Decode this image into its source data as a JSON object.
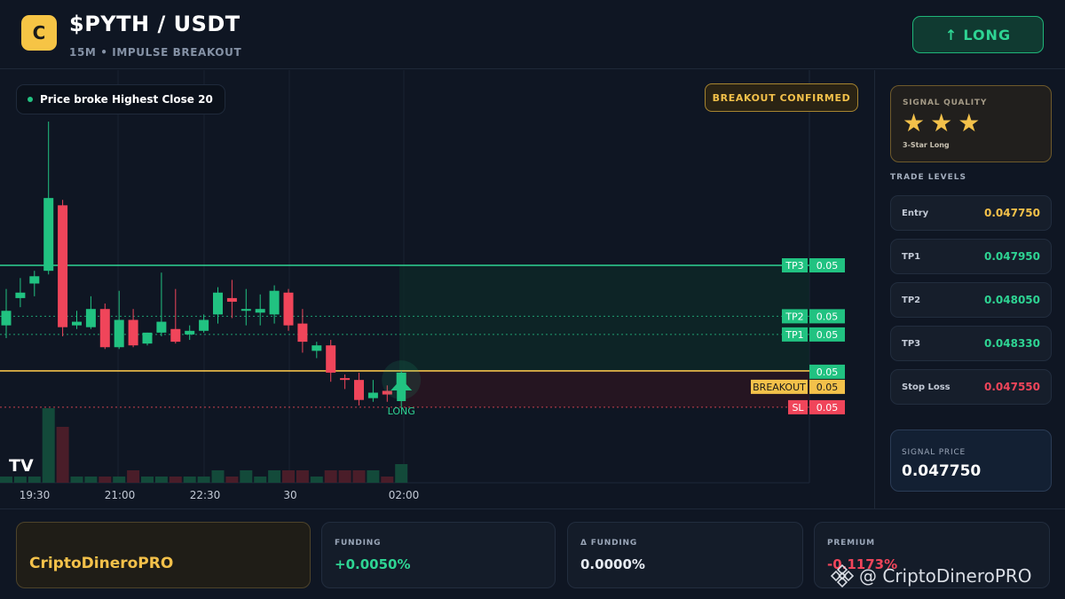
{
  "header": {
    "logo_letter": "C",
    "pair": "$PYTH / USDT",
    "subtitle": "15M • IMPULSE BREAKOUT",
    "long_button": "LONG",
    "long_arrow": "↑"
  },
  "chart": {
    "info_pill": "Price broke Highest Close 20",
    "badge": "BREAKOUT CONFIRMED",
    "signal_marker_label": "LONG",
    "tv_logo": "TV",
    "time_labels": [
      "19:30",
      "21:00",
      "22:30",
      "30",
      "02:00"
    ],
    "price_tags": [
      {
        "name": "TP3",
        "value": "0.05"
      },
      {
        "name": "TP2",
        "value": "0.05"
      },
      {
        "name": "TP1",
        "value": "0.05"
      },
      {
        "name": "",
        "value": "0.05"
      },
      {
        "name": "BREAKOUT",
        "value": "0.05"
      },
      {
        "name": "SL",
        "value": "0.05"
      }
    ],
    "colors": {
      "up": "#21c281",
      "down": "#f0455a",
      "breakout": "#f3c14a"
    }
  },
  "chart_data": {
    "type": "candlestick",
    "price_levels": {
      "TP3": 0.04833,
      "TP2": 0.04805,
      "TP1": 0.04795,
      "Entry": 0.04775,
      "Stop Loss": 0.04755
    },
    "candles": [
      {
        "o": 0.048,
        "h": 0.0482,
        "l": 0.04793,
        "c": 0.04808,
        "v": 1
      },
      {
        "o": 0.04815,
        "h": 0.04826,
        "l": 0.0481,
        "c": 0.04818,
        "v": 1
      },
      {
        "o": 0.04823,
        "h": 0.0483,
        "l": 0.04816,
        "c": 0.04827,
        "v": 1
      },
      {
        "o": 0.0483,
        "h": 0.04912,
        "l": 0.04828,
        "c": 0.0487,
        "v": 12
      },
      {
        "o": 0.04866,
        "h": 0.04869,
        "l": 0.04794,
        "c": 0.04799,
        "v": 9
      },
      {
        "o": 0.048,
        "h": 0.04808,
        "l": 0.04798,
        "c": 0.04802,
        "v": 1
      },
      {
        "o": 0.04799,
        "h": 0.04816,
        "l": 0.04798,
        "c": 0.04809,
        "v": 1
      },
      {
        "o": 0.04809,
        "h": 0.04812,
        "l": 0.04787,
        "c": 0.04788,
        "v": 1
      },
      {
        "o": 0.04788,
        "h": 0.04819,
        "l": 0.04787,
        "c": 0.04803,
        "v": 1
      },
      {
        "o": 0.04803,
        "h": 0.04809,
        "l": 0.04788,
        "c": 0.04789,
        "v": 2
      },
      {
        "o": 0.0479,
        "h": 0.04796,
        "l": 0.04789,
        "c": 0.04796,
        "v": 1
      },
      {
        "o": 0.04796,
        "h": 0.04829,
        "l": 0.04794,
        "c": 0.04802,
        "v": 1
      },
      {
        "o": 0.04798,
        "h": 0.0482,
        "l": 0.0479,
        "c": 0.04791,
        "v": 1
      },
      {
        "o": 0.04795,
        "h": 0.048,
        "l": 0.04792,
        "c": 0.04797,
        "v": 1
      },
      {
        "o": 0.04797,
        "h": 0.04806,
        "l": 0.04796,
        "c": 0.04803,
        "v": 1
      },
      {
        "o": 0.04806,
        "h": 0.04821,
        "l": 0.04801,
        "c": 0.04818,
        "v": 2
      },
      {
        "o": 0.04815,
        "h": 0.04825,
        "l": 0.04804,
        "c": 0.04813,
        "v": 1
      },
      {
        "o": 0.04808,
        "h": 0.0482,
        "l": 0.048,
        "c": 0.04809,
        "v": 2
      },
      {
        "o": 0.04807,
        "h": 0.04817,
        "l": 0.048,
        "c": 0.04809,
        "v": 1
      },
      {
        "o": 0.04806,
        "h": 0.04822,
        "l": 0.04801,
        "c": 0.04819,
        "v": 2
      },
      {
        "o": 0.04818,
        "h": 0.0482,
        "l": 0.04797,
        "c": 0.048,
        "v": 2
      },
      {
        "o": 0.04801,
        "h": 0.04809,
        "l": 0.04785,
        "c": 0.04791,
        "v": 2
      },
      {
        "o": 0.04786,
        "h": 0.04791,
        "l": 0.04782,
        "c": 0.04789,
        "v": 1
      },
      {
        "o": 0.04789,
        "h": 0.04792,
        "l": 0.04769,
        "c": 0.04774,
        "v": 2
      },
      {
        "o": 0.04771,
        "h": 0.04773,
        "l": 0.04765,
        "c": 0.0477,
        "v": 2
      },
      {
        "o": 0.0477,
        "h": 0.04774,
        "l": 0.04756,
        "c": 0.04759,
        "v": 2
      },
      {
        "o": 0.0476,
        "h": 0.0477,
        "l": 0.04758,
        "c": 0.04763,
        "v": 2
      },
      {
        "o": 0.04764,
        "h": 0.04767,
        "l": 0.04758,
        "c": 0.04762,
        "v": 1
      },
      {
        "o": 0.04765,
        "h": 0.04775,
        "l": 0.04755,
        "c": 0.04774,
        "v": 3
      }
    ],
    "x_labels": [
      "19:30",
      "21:00",
      "22:30",
      "30",
      "02:00"
    ]
  },
  "panel": {
    "quality_label": "SIGNAL QUALITY",
    "stars": 3,
    "quality_desc": "3-Star Long",
    "trade_levels_title": "TRADE LEVELS",
    "levels": [
      {
        "label": "Entry",
        "value": "0.047750",
        "color": "#f3c14a"
      },
      {
        "label": "TP1",
        "value": "0.047950",
        "color": "#2ed493"
      },
      {
        "label": "TP2",
        "value": "0.048050",
        "color": "#2ed493"
      },
      {
        "label": "TP3",
        "value": "0.048330",
        "color": "#2ed493"
      },
      {
        "label": "Stop Loss",
        "value": "0.047550",
        "color": "#f0455a"
      }
    ],
    "signal_price_label": "SIGNAL PRICE",
    "signal_price": "0.047750"
  },
  "footer": {
    "brand": "CriptoDineroPRO",
    "funding_label": "FUNDING",
    "funding_value": "+0.0050%",
    "dfunding_label": "Δ FUNDING",
    "dfunding_value": "0.0000%",
    "premium_label": "PREMIUM",
    "premium_value": "-0.1173%",
    "watermark": "@ CriptoDineroPRO"
  }
}
